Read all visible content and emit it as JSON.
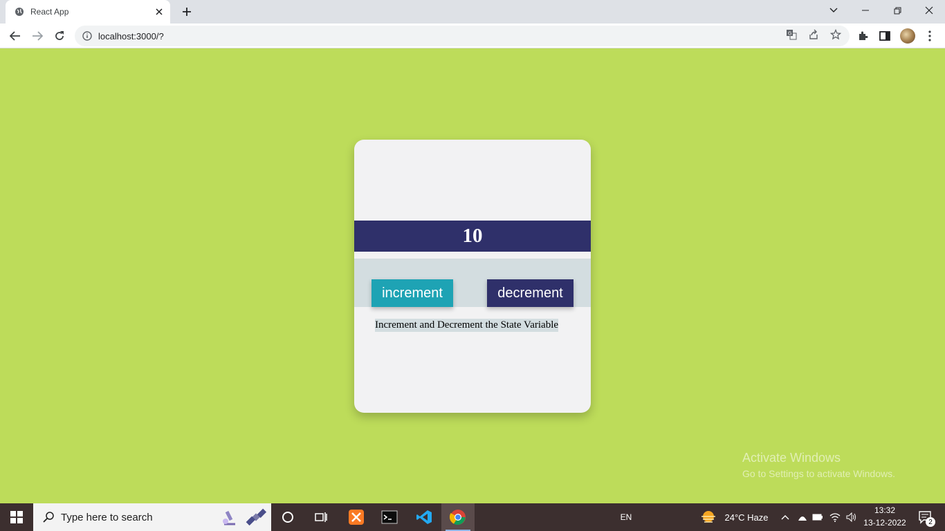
{
  "browser": {
    "tab_title": "React App",
    "url": "localhost:3000/?"
  },
  "app": {
    "count": "10",
    "increment_label": "increment",
    "decrement_label": "decrement",
    "caption": "Increment and Decrement the State Variable"
  },
  "watermark": {
    "line1": "Activate Windows",
    "line2": "Go to Settings to activate Windows."
  },
  "taskbar": {
    "search_placeholder": "Type here to search",
    "language": "EN",
    "weather": "24°C  Haze",
    "time": "13:32",
    "date": "13-12-2022",
    "notifications": "2"
  },
  "colors": {
    "page_background": "#bddc5a",
    "count_bar": "#2f306a",
    "increment_button": "#1ea3b4",
    "decrement_button": "#2f306a"
  }
}
